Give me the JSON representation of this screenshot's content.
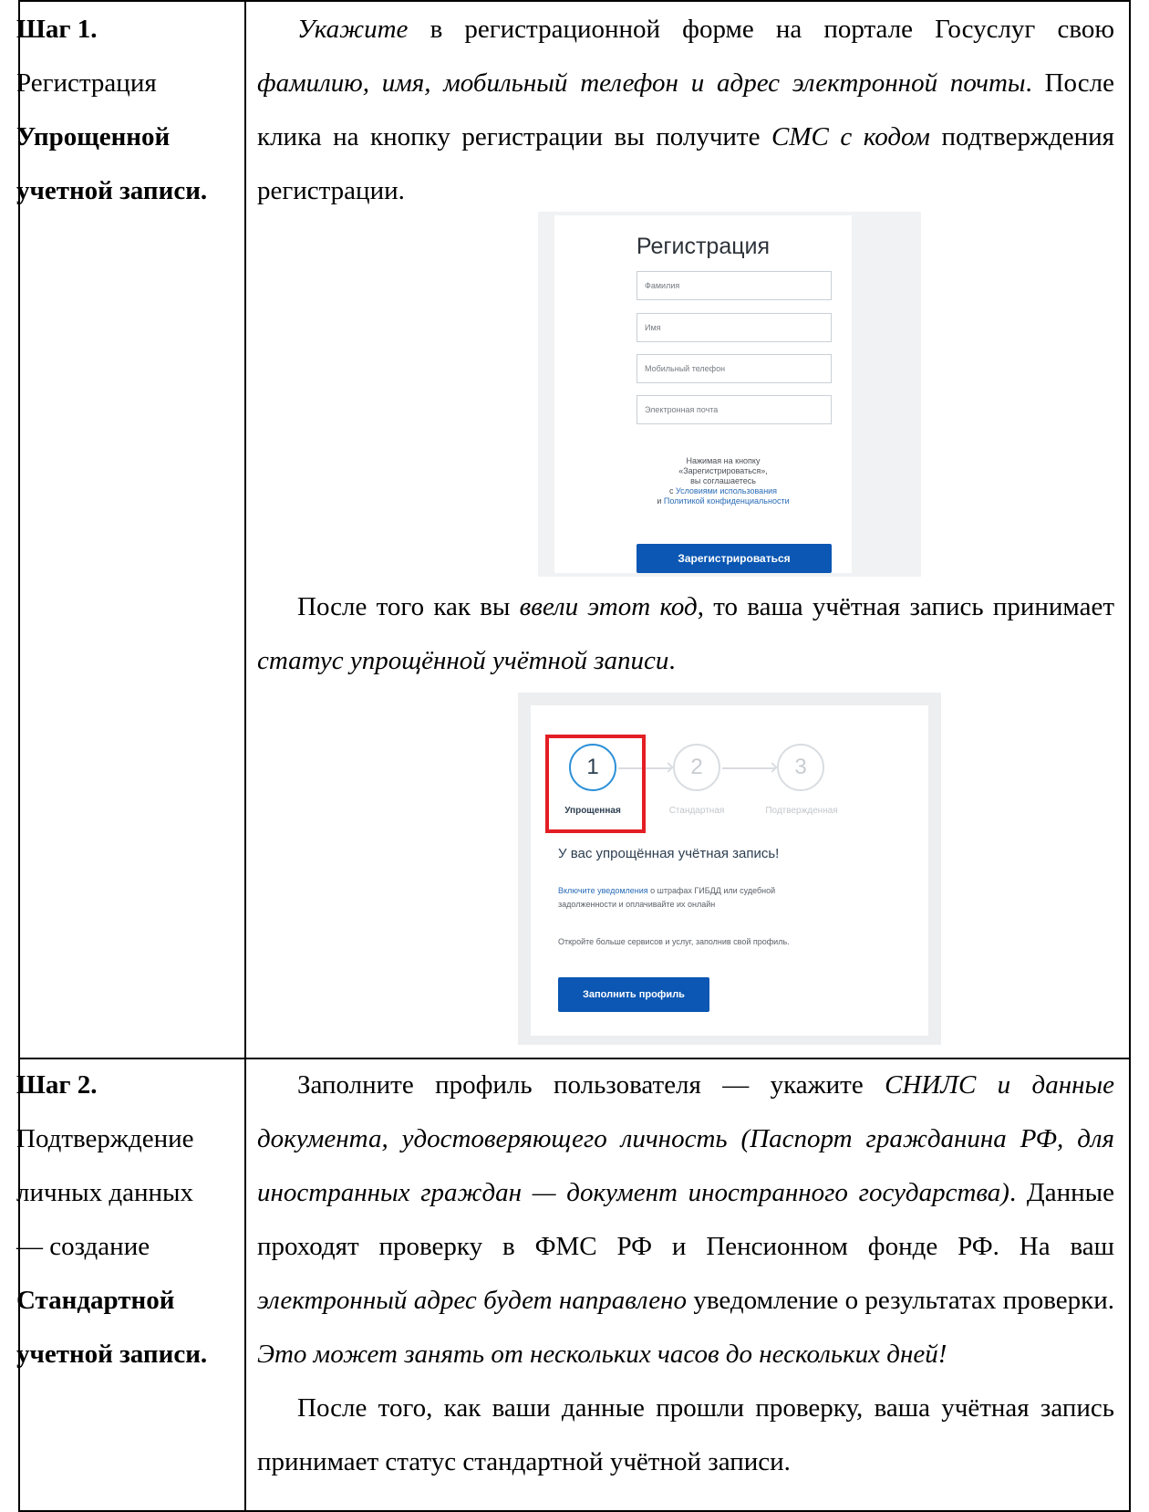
{
  "step1": {
    "label": [
      "Шаг 1.",
      "Регистрация",
      "Упрощенной",
      "учетной записи."
    ],
    "p1": {
      "i1": "Укажите",
      "t1": " в регистрационной форме на портале Госуслуг свою ",
      "i2": "фамилию, имя, мобильный телефон и адрес электронной почты",
      "t2": ". После клика на кнопку регистрации вы получите ",
      "i3": "СМС с кодом",
      "t3": " подтверждения регистрации."
    },
    "p2": {
      "t1": "После того как вы ",
      "i1": "ввели этот код",
      "t2": ", то ваша учётная запись принимает ",
      "i2": "статус упрощённой учётной записи",
      "t3": "."
    },
    "registration_form": {
      "title": "Регистрация",
      "fields": [
        {
          "placeholder": "Фамилия"
        },
        {
          "placeholder": "Имя"
        },
        {
          "placeholder": "Мобильный телефон"
        },
        {
          "placeholder": "Электронная почта"
        }
      ],
      "consent": {
        "line1": "Нажимая на кнопку",
        "line2": "«Зарегистрироваться»,",
        "line3": "вы соглашаетесь",
        "line4_prefix": "с ",
        "terms_link": "Условиями использования",
        "line5_prefix": "и ",
        "privacy_link": "Политикой конфиденциальности"
      },
      "submit_label": "Зарегистрироваться"
    },
    "status_card": {
      "steps": [
        {
          "number": "1",
          "label": "Упрощенная"
        },
        {
          "number": "2",
          "label": "Стандартная"
        },
        {
          "number": "3",
          "label": "Подтвержденная"
        }
      ],
      "title": "У вас упрощённая учётная запись!",
      "notify_link": "Включите уведомления",
      "notify_text1": " о штрафах ГИБДД или судебной",
      "notify_text2": "задолженности и оплачивайте их онлайн",
      "profile_text": "Откройте больше сервисов и услуг, заполнив свой профиль.",
      "button_label": "Заполнить профиль"
    }
  },
  "step2": {
    "label": [
      "Шаг 2.",
      "Подтверждение",
      "личных данных",
      "— создание",
      "Стандартной",
      "учетной записи."
    ],
    "p1": {
      "t1": "Заполните профиль пользователя — укажите ",
      "i1": "СНИЛС и данные документа, удостоверяющего личность (Паспорт гражданина РФ, для иностранных граждан — документ иностранного государства)",
      "t2": ". Данные проходят проверку в ФМС РФ и Пенсионном фонде РФ. На ваш ",
      "i2": "электронный адрес будет направлено",
      "t3": " уведомление о результатах проверки. ",
      "i3": "Это может занять от нескольких часов до нескольких дней!"
    },
    "p2": "После того, как ваши данные прошли проверку, ваша учётная запись принимает статус стандартной учётной записи."
  }
}
